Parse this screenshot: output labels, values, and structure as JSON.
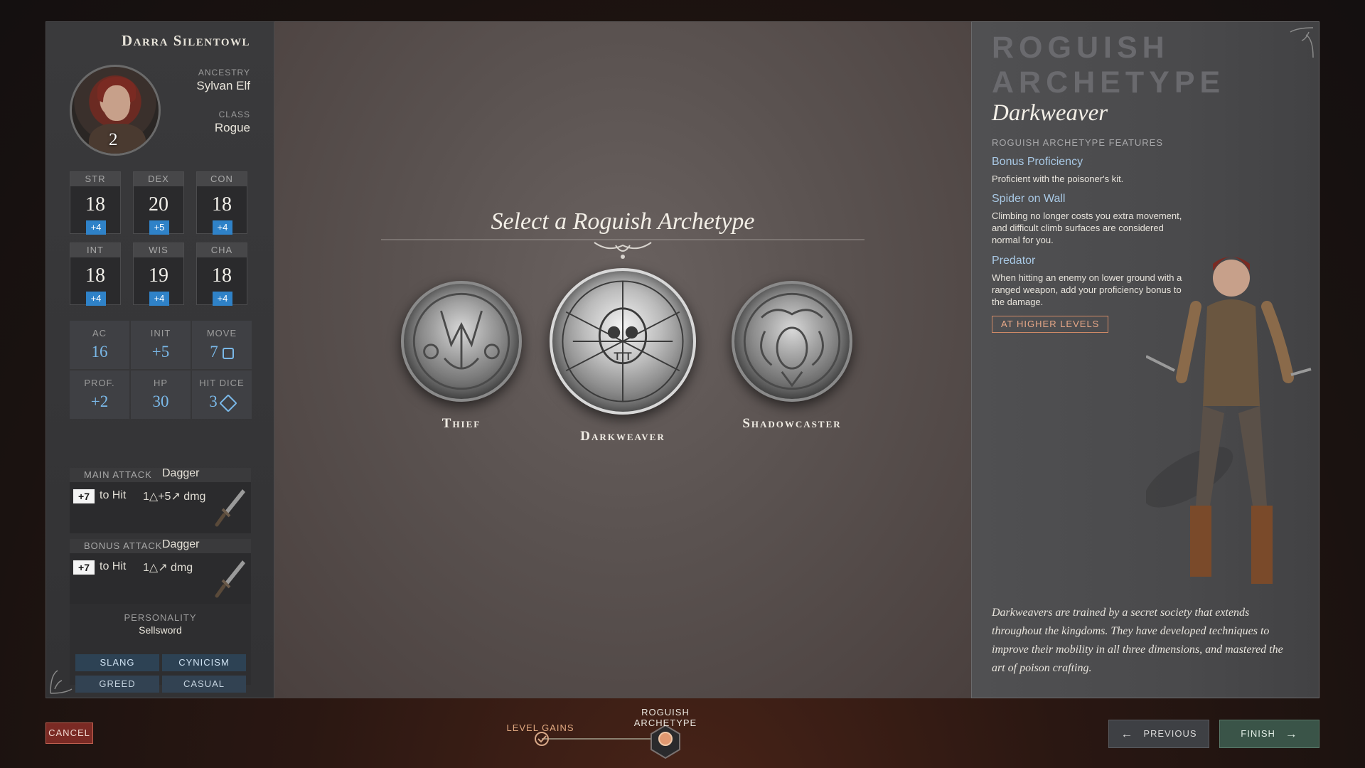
{
  "character": {
    "name": "Darra Silentowl",
    "level": "2",
    "ancestry_label": "ANCESTRY",
    "ancestry": "Sylvan Elf",
    "class_label": "CLASS",
    "class": "Rogue"
  },
  "abilities": [
    {
      "label": "STR",
      "value": "18",
      "mod": "+4"
    },
    {
      "label": "DEX",
      "value": "20",
      "mod": "+5"
    },
    {
      "label": "CON",
      "value": "18",
      "mod": "+4"
    },
    {
      "label": "INT",
      "value": "18",
      "mod": "+4"
    },
    {
      "label": "WIS",
      "value": "19",
      "mod": "+4"
    },
    {
      "label": "CHA",
      "value": "18",
      "mod": "+4"
    }
  ],
  "derived": [
    {
      "label": "AC",
      "value": "16"
    },
    {
      "label": "INIT",
      "value": "+5"
    },
    {
      "label": "MOVE",
      "value": "7"
    },
    {
      "label": "PROF.",
      "value": "+2"
    },
    {
      "label": "HP",
      "value": "30"
    },
    {
      "label": "HIT DICE",
      "value": "3"
    }
  ],
  "attacks": {
    "main": {
      "label": "MAIN ATTACK",
      "weapon": "Dagger",
      "to_hit": "+7",
      "to_hit_text": "to Hit",
      "dmg": "1△+5↗ dmg"
    },
    "bonus": {
      "label": "BONUS ATTACK",
      "weapon": "Dagger",
      "to_hit": "+7",
      "to_hit_text": "to Hit",
      "dmg": "1△↗ dmg"
    }
  },
  "personality": {
    "label": "PERSONALITY",
    "value": "Sellsword",
    "traits": [
      "SLANG",
      "CYNICISM",
      "GREED",
      "CASUAL"
    ]
  },
  "center": {
    "title": "Select a Roguish Archetype",
    "archetypes": [
      {
        "label": "Thief"
      },
      {
        "label": "Darkweaver"
      },
      {
        "label": "Shadowcaster"
      }
    ]
  },
  "detail": {
    "heading": "ROGUISH ARCHETYPE",
    "subtitle": "Darkweaver",
    "features_label": "ROGUISH ARCHETYPE FEATURES",
    "features": [
      {
        "name": "Bonus Proficiency",
        "desc": "Proficient with the poisoner's kit."
      },
      {
        "name": "Spider on Wall",
        "desc": "Climbing no longer costs you extra movement, and difficult climb surfaces are considered normal for you."
      },
      {
        "name": "Predator",
        "desc": "When hitting an enemy on lower ground with a ranged weapon, add your proficiency bonus to the damage."
      }
    ],
    "higher_levels": "AT HIGHER LEVELS",
    "flavor": "Darkweavers are trained by a secret society that extends throughout the kingdoms. They have developed techniques to improve their mobility in all three dimensions, and mastered the art of poison crafting."
  },
  "footer": {
    "cancel": "CANCEL",
    "steps": [
      {
        "label": "LEVEL GAINS"
      },
      {
        "label": "ROGUISH ARCHETYPE"
      }
    ],
    "previous": "PREVIOUS",
    "finish": "FINISH"
  },
  "colors": {
    "accent_blue": "#2f82c8",
    "value_blue": "#7ab8e8",
    "cancel_red": "#7a2a24",
    "finish_green": "#3a5448",
    "highlight_orange": "#e8a888"
  }
}
